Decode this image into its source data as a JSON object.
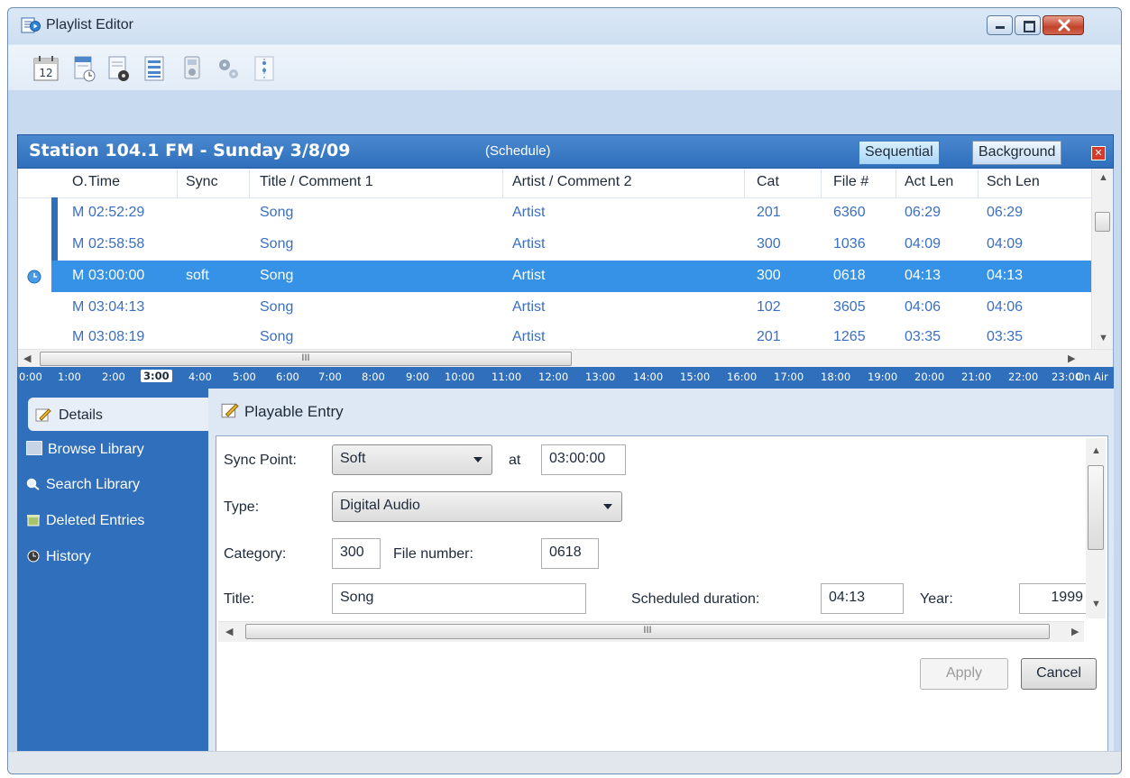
{
  "window": {
    "title": "Playlist Editor",
    "app_icon": "playlist-app-icon"
  },
  "toolbar": {
    "icons": [
      "calendar-icon",
      "schedule-clock-icon",
      "schedule-disc-icon",
      "list-view-icon",
      "media-player-icon",
      "settings-gears-icon",
      "timeline-icon"
    ],
    "calendar_day": "12"
  },
  "schedule": {
    "station": "Station 104.1 FM - Sunday 3/8/09",
    "mode_label": "(Schedule)",
    "sequential_label": "Sequential",
    "background_label": "Background",
    "close_glyph": "✕"
  },
  "grid": {
    "columns": [
      "O.",
      "Time",
      "Sync",
      "Title / Comment 1",
      "Artist / Comment 2",
      "Cat",
      "File #",
      "Act Len",
      "Sch Len"
    ],
    "rows": [
      {
        "o": "M",
        "time": "02:52:29",
        "sync": "",
        "title": "Song",
        "artist": "Artist",
        "cat": "201",
        "file": "6360",
        "act": "06:29",
        "sch": "06:29"
      },
      {
        "o": "M",
        "time": "02:58:58",
        "sync": "",
        "title": "Song",
        "artist": "Artist",
        "cat": "300",
        "file": "1036",
        "act": "04:09",
        "sch": "04:09"
      },
      {
        "o": "M",
        "time": "03:00:00",
        "sync": "soft",
        "title": "Song",
        "artist": "Artist",
        "cat": "300",
        "file": "0618",
        "act": "04:13",
        "sch": "04:13"
      },
      {
        "o": "M",
        "time": "03:04:13",
        "sync": "",
        "title": "Song",
        "artist": "Artist",
        "cat": "102",
        "file": "3605",
        "act": "04:06",
        "sch": "04:06"
      },
      {
        "o": "M",
        "time": "03:08:19",
        "sync": "",
        "title": "Song",
        "artist": "Artist",
        "cat": "201",
        "file": "1265",
        "act": "03:35",
        "sch": "03:35"
      }
    ],
    "scroll_grip": "III"
  },
  "timeline": {
    "hours": [
      "0:00",
      "1:00",
      "2:00",
      "3:00",
      "4:00",
      "5:00",
      "6:00",
      "7:00",
      "8:00",
      "9:00",
      "10:00",
      "11:00",
      "12:00",
      "13:00",
      "14:00",
      "15:00",
      "16:00",
      "17:00",
      "18:00",
      "19:00",
      "20:00",
      "21:00",
      "22:00",
      "23:00"
    ],
    "current": "3:00",
    "on_air": "On Air"
  },
  "nav": {
    "items": [
      {
        "label": "Details",
        "icon": "edit-icon"
      },
      {
        "label": "Browse Library",
        "icon": "book-icon"
      },
      {
        "label": "Search Library",
        "icon": "magnifier-icon"
      },
      {
        "label": "Deleted Entries",
        "icon": "trash-icon"
      },
      {
        "label": "History",
        "icon": "clock-icon"
      }
    ]
  },
  "details": {
    "title": "Playable Entry",
    "sync_point_label": "Sync Point:",
    "sync_point_value": "Soft",
    "at_label": "at",
    "at_value": "03:00:00",
    "type_label": "Type:",
    "type_value": "Digital Audio",
    "category_label": "Category:",
    "category_value": "300",
    "file_number_label": "File number:",
    "file_number_value": "0618",
    "title_label": "Title:",
    "title_value": "Song",
    "sched_duration_label": "Scheduled duration:",
    "sched_duration_value": "04:13",
    "year_label": "Year:",
    "year_value": "1999",
    "scroll_grip": "III",
    "apply_label": "Apply",
    "cancel_label": "Cancel"
  }
}
